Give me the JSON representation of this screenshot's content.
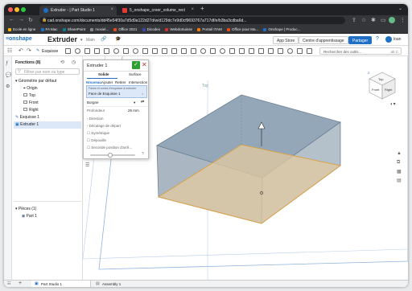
{
  "browser": {
    "tabs": [
      {
        "title": "Extruder - | Part Studio 1",
        "active": true
      },
      {
        "title": "5_onshape_creer_volume_rect",
        "active": false
      }
    ],
    "url": "cad.onshape.com/documents/dd45e54f30a7d5d9a122d27d/w/d129dc7e9d0cf9693767a717df/e/b3ba3cdba6d...",
    "bookmarks": [
      "Ecole en ligne",
      "FA Mac",
      "SharePoint",
      "moxiel...",
      "Office 2021",
      "Dicodeo",
      "WebdoSuisse",
      "Portail ITAM",
      "Office pour Ma...",
      "Onshape | Produc..."
    ]
  },
  "header": {
    "logo": "onshape",
    "doc_title": "Extruder",
    "branch": "Main",
    "app_store": "App Store",
    "learning_center": "Centre d'apprentissage",
    "share": "Partager",
    "user": "loan"
  },
  "toolbar": {
    "sketch": "Esquisse",
    "search_placeholder": "Rechercher des outils...",
    "search_shortcut": "alt C"
  },
  "features": {
    "header": "Fonctions (8)",
    "filter_placeholder": "Filtrer par nom ou type",
    "default_geometry": "Géométrie par défaut",
    "items": [
      "Origin",
      "Top",
      "Front",
      "Right"
    ],
    "sketch1": "Esquisse 1",
    "extrude1": "Extruder 1",
    "parts_header": "Pièces (1)",
    "part1": "Part 1"
  },
  "dialog": {
    "title": "Extruder 1",
    "tab_solid": "Solide",
    "tab_surface": "Surface",
    "ops": [
      "Nouveau",
      "Ajouter",
      "Retirer",
      "Intersection"
    ],
    "faces_label": "Faces et zones d'esquisse à extruder",
    "faces_value": "Face de Esquisse 1",
    "end_type": "Borgne",
    "depth_label": "Profondeur",
    "depth_value": "25 mm",
    "direction": "Direction",
    "offset": "Décalage de départ",
    "symmetric": "Symétrique",
    "draft": "Dépouille",
    "second_end": "Seconde position d'arrê..."
  },
  "viewport": {
    "top_label": "Top",
    "front_label": "Front",
    "right_label": "Right",
    "cube_top": "Top",
    "cube_front": "Front",
    "cube_right": "Right",
    "axis_z": "Z",
    "axis_x": "X",
    "axis_y": "Y"
  },
  "tabs_bottom": {
    "part_studio": "Part Studio 1",
    "assembly": "Assembly 1"
  },
  "colors": {
    "accent": "#1f6fc5",
    "solid_face": "#93a7b9",
    "sketch_face": "#e3caa0",
    "confirm": "#2f9e33",
    "cancel": "#d93025"
  }
}
